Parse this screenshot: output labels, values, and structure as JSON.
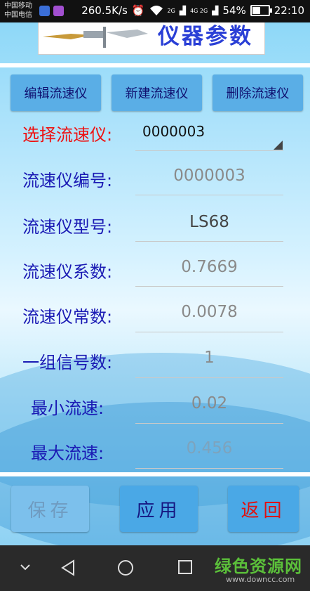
{
  "status_bar": {
    "carrier1": "中国移动",
    "carrier2": "中国电信",
    "speed": "260.5K/s",
    "network1": "2G",
    "network2": "4G 2G",
    "battery": "54%",
    "battery_level": 0.54,
    "time": "22:10"
  },
  "banner": {
    "title": "仪器参数"
  },
  "toolbar": {
    "edit_label": "编辑流速仪",
    "new_label": "新建流速仪",
    "delete_label": "删除流速仪"
  },
  "form": {
    "select_label": "选择流速仪:",
    "select_value": "0000003",
    "rows": [
      {
        "label": "流速仪编号:",
        "value": "0000003"
      },
      {
        "label": "流速仪型号:",
        "value": "LS68"
      },
      {
        "label": "流速仪系数:",
        "value": "0.7669"
      },
      {
        "label": "流速仪常数:",
        "value": "0.0078"
      },
      {
        "label": "一组信号数:",
        "value": "1"
      },
      {
        "label": "最小流速:",
        "value": "0.02"
      },
      {
        "label": "最大流速:",
        "value": "0.456"
      }
    ]
  },
  "actions": {
    "save_label": "保存",
    "apply_label": "应用",
    "back_label": "返回"
  },
  "colors": {
    "label_blue": "#1a1ab4",
    "label_red": "#ee1111",
    "button_blue": "#5aaee6",
    "title_blue": "#2a3fd6"
  },
  "watermark": {
    "logo": "绿色资源网",
    "url": "www.downcc.com"
  }
}
